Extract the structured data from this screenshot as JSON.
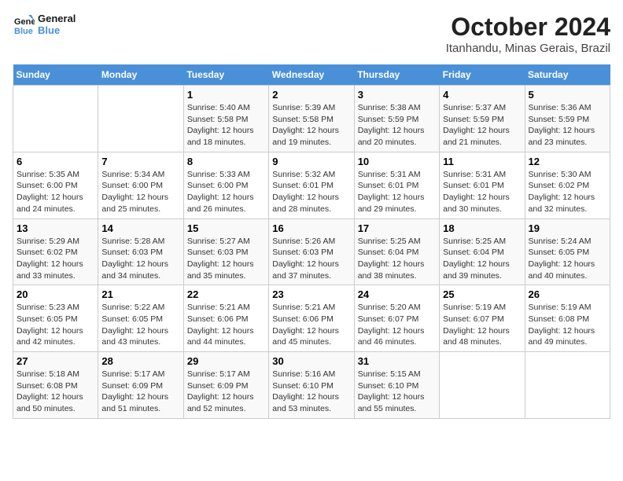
{
  "logo": {
    "line1": "General",
    "line2": "Blue"
  },
  "title": "October 2024",
  "location": "Itanhandu, Minas Gerais, Brazil",
  "weekdays": [
    "Sunday",
    "Monday",
    "Tuesday",
    "Wednesday",
    "Thursday",
    "Friday",
    "Saturday"
  ],
  "weeks": [
    [
      null,
      null,
      {
        "day": 1,
        "sunrise": "5:40 AM",
        "sunset": "5:58 PM",
        "daylight": "12 hours and 18 minutes."
      },
      {
        "day": 2,
        "sunrise": "5:39 AM",
        "sunset": "5:58 PM",
        "daylight": "12 hours and 19 minutes."
      },
      {
        "day": 3,
        "sunrise": "5:38 AM",
        "sunset": "5:59 PM",
        "daylight": "12 hours and 20 minutes."
      },
      {
        "day": 4,
        "sunrise": "5:37 AM",
        "sunset": "5:59 PM",
        "daylight": "12 hours and 21 minutes."
      },
      {
        "day": 5,
        "sunrise": "5:36 AM",
        "sunset": "5:59 PM",
        "daylight": "12 hours and 23 minutes."
      }
    ],
    [
      {
        "day": 6,
        "sunrise": "5:35 AM",
        "sunset": "6:00 PM",
        "daylight": "12 hours and 24 minutes."
      },
      {
        "day": 7,
        "sunrise": "5:34 AM",
        "sunset": "6:00 PM",
        "daylight": "12 hours and 25 minutes."
      },
      {
        "day": 8,
        "sunrise": "5:33 AM",
        "sunset": "6:00 PM",
        "daylight": "12 hours and 26 minutes."
      },
      {
        "day": 9,
        "sunrise": "5:32 AM",
        "sunset": "6:01 PM",
        "daylight": "12 hours and 28 minutes."
      },
      {
        "day": 10,
        "sunrise": "5:31 AM",
        "sunset": "6:01 PM",
        "daylight": "12 hours and 29 minutes."
      },
      {
        "day": 11,
        "sunrise": "5:31 AM",
        "sunset": "6:01 PM",
        "daylight": "12 hours and 30 minutes."
      },
      {
        "day": 12,
        "sunrise": "5:30 AM",
        "sunset": "6:02 PM",
        "daylight": "12 hours and 32 minutes."
      }
    ],
    [
      {
        "day": 13,
        "sunrise": "5:29 AM",
        "sunset": "6:02 PM",
        "daylight": "12 hours and 33 minutes."
      },
      {
        "day": 14,
        "sunrise": "5:28 AM",
        "sunset": "6:03 PM",
        "daylight": "12 hours and 34 minutes."
      },
      {
        "day": 15,
        "sunrise": "5:27 AM",
        "sunset": "6:03 PM",
        "daylight": "12 hours and 35 minutes."
      },
      {
        "day": 16,
        "sunrise": "5:26 AM",
        "sunset": "6:03 PM",
        "daylight": "12 hours and 37 minutes."
      },
      {
        "day": 17,
        "sunrise": "5:25 AM",
        "sunset": "6:04 PM",
        "daylight": "12 hours and 38 minutes."
      },
      {
        "day": 18,
        "sunrise": "5:25 AM",
        "sunset": "6:04 PM",
        "daylight": "12 hours and 39 minutes."
      },
      {
        "day": 19,
        "sunrise": "5:24 AM",
        "sunset": "6:05 PM",
        "daylight": "12 hours and 40 minutes."
      }
    ],
    [
      {
        "day": 20,
        "sunrise": "5:23 AM",
        "sunset": "6:05 PM",
        "daylight": "12 hours and 42 minutes."
      },
      {
        "day": 21,
        "sunrise": "5:22 AM",
        "sunset": "6:05 PM",
        "daylight": "12 hours and 43 minutes."
      },
      {
        "day": 22,
        "sunrise": "5:21 AM",
        "sunset": "6:06 PM",
        "daylight": "12 hours and 44 minutes."
      },
      {
        "day": 23,
        "sunrise": "5:21 AM",
        "sunset": "6:06 PM",
        "daylight": "12 hours and 45 minutes."
      },
      {
        "day": 24,
        "sunrise": "5:20 AM",
        "sunset": "6:07 PM",
        "daylight": "12 hours and 46 minutes."
      },
      {
        "day": 25,
        "sunrise": "5:19 AM",
        "sunset": "6:07 PM",
        "daylight": "12 hours and 48 minutes."
      },
      {
        "day": 26,
        "sunrise": "5:19 AM",
        "sunset": "6:08 PM",
        "daylight": "12 hours and 49 minutes."
      }
    ],
    [
      {
        "day": 27,
        "sunrise": "5:18 AM",
        "sunset": "6:08 PM",
        "daylight": "12 hours and 50 minutes."
      },
      {
        "day": 28,
        "sunrise": "5:17 AM",
        "sunset": "6:09 PM",
        "daylight": "12 hours and 51 minutes."
      },
      {
        "day": 29,
        "sunrise": "5:17 AM",
        "sunset": "6:09 PM",
        "daylight": "12 hours and 52 minutes."
      },
      {
        "day": 30,
        "sunrise": "5:16 AM",
        "sunset": "6:10 PM",
        "daylight": "12 hours and 53 minutes."
      },
      {
        "day": 31,
        "sunrise": "5:15 AM",
        "sunset": "6:10 PM",
        "daylight": "12 hours and 55 minutes."
      },
      null,
      null
    ]
  ]
}
